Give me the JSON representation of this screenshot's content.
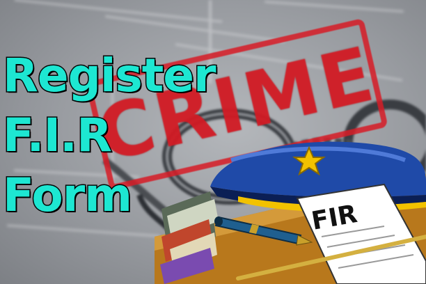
{
  "title": {
    "line1": "Register",
    "line2": "F.I.R",
    "line3": "Form"
  },
  "stamp": {
    "text": "CRIME",
    "color": "#d61c26"
  },
  "document": {
    "label": "FIR"
  },
  "colors": {
    "title_fill": "#1de7d2",
    "title_outline": "#050505",
    "cap": "#1f4aa8",
    "badge": "#f2c200",
    "pen_barrel": "#1f5f8f",
    "pen_trim": "#c9a02a"
  },
  "icons": [
    "handcuffs-icon",
    "police-cap-icon",
    "badge-star-icon",
    "fountain-pen-icon",
    "fir-document-icon",
    "book-stack-icon",
    "baton-icon"
  ]
}
